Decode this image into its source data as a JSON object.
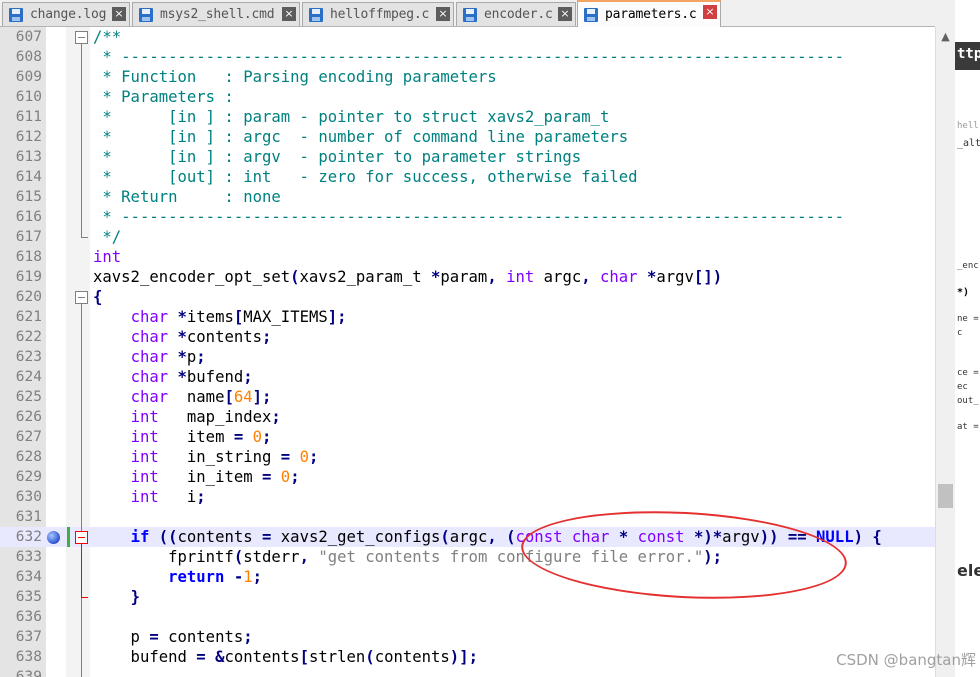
{
  "tabs": [
    {
      "label": "change.log",
      "close": "×"
    },
    {
      "label": "msys2_shell.cmd",
      "close": "×"
    },
    {
      "label": "helloffmpeg.c",
      "close": "×"
    },
    {
      "label": "encoder.c",
      "close": "×"
    },
    {
      "label": "parameters.c",
      "close": "×"
    }
  ],
  "editor": {
    "lines": [
      {
        "n": "607",
        "code": "/**"
      },
      {
        "n": "608",
        "code": " * -----------------------------------------------------------------------------"
      },
      {
        "n": "609",
        "code": " * Function   : Parsing encoding parameters"
      },
      {
        "n": "610",
        "code": " * Parameters :"
      },
      {
        "n": "611",
        "code": " *      [in ] : param - pointer to struct xavs2_param_t"
      },
      {
        "n": "612",
        "code": " *      [in ] : argc  - number of command line parameters"
      },
      {
        "n": "613",
        "code": " *      [in ] : argv  - pointer to parameter strings"
      },
      {
        "n": "614",
        "code": " *      [out] : int   - zero for success, otherwise failed"
      },
      {
        "n": "615",
        "code": " * Return     : none"
      },
      {
        "n": "616",
        "code": " * -----------------------------------------------------------------------------"
      },
      {
        "n": "617",
        "code": " */"
      },
      {
        "n": "618",
        "code": "int"
      },
      {
        "n": "619",
        "code": "xavs2_encoder_opt_set(xavs2_param_t *param, int argc, char *argv[])"
      },
      {
        "n": "620",
        "code": "{"
      },
      {
        "n": "621",
        "code": "    char *items[MAX_ITEMS];"
      },
      {
        "n": "622",
        "code": "    char *contents;"
      },
      {
        "n": "623",
        "code": "    char *p;"
      },
      {
        "n": "624",
        "code": "    char *bufend;"
      },
      {
        "n": "625",
        "code": "    char  name[64];"
      },
      {
        "n": "626",
        "code": "    int   map_index;"
      },
      {
        "n": "627",
        "code": "    int   item = 0;"
      },
      {
        "n": "628",
        "code": "    int   in_string = 0;"
      },
      {
        "n": "629",
        "code": "    int   in_item = 0;"
      },
      {
        "n": "630",
        "code": "    int   i;"
      },
      {
        "n": "631",
        "code": ""
      },
      {
        "n": "632",
        "code": "    if ((contents = xavs2_get_configs(argc, (const char * const *)*argv)) == NULL) {"
      },
      {
        "n": "633",
        "code": "        fprintf(stderr, \"get contents from configure file error.\");"
      },
      {
        "n": "634",
        "code": "        return -1;"
      },
      {
        "n": "635",
        "code": "    }"
      },
      {
        "n": "636",
        "code": ""
      },
      {
        "n": "637",
        "code": "    p = contents;"
      },
      {
        "n": "638",
        "code": "    bufend = &contents[strlen(contents)];"
      },
      {
        "n": "639",
        "code": ""
      }
    ]
  },
  "scrollbar": {
    "up_arrow": "▲"
  },
  "background_window": {
    "fragments": [
      "ttp",
      "hell",
      "_alt",
      "_enc",
      "*)",
      "ne =",
      "c",
      "ce =",
      "ec",
      "out_",
      "at =",
      "ele"
    ]
  },
  "watermark": "CSDN @bangtan辉"
}
